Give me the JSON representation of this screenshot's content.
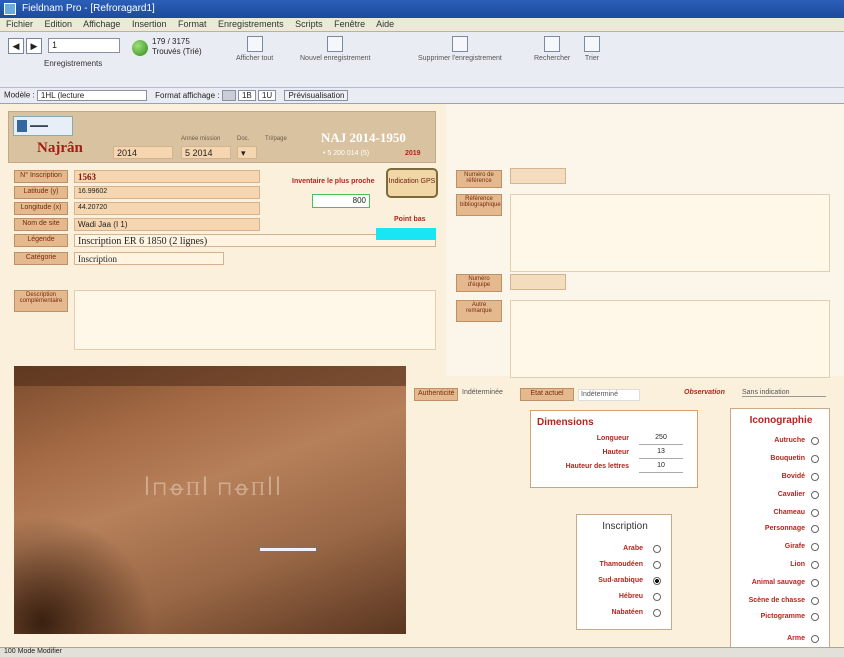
{
  "window": {
    "title": "Fieldnam Pro - [Refroragard1]"
  },
  "menu": [
    "Fichier",
    "Edition",
    "Affichage",
    "Insertion",
    "Format",
    "Enregistrements",
    "Scripts",
    "Fenêtre",
    "Aide"
  ],
  "toolbar": {
    "record_label": "Enregistrements",
    "record_input": "1",
    "found_count": "179 / 3175",
    "found_label": "Trouvés (Trié)",
    "tools": [
      "Afficher tout",
      "Nouvel enregistrement",
      "Supprimer l'enregistrement",
      "Rechercher",
      "Trier"
    ]
  },
  "layoutbar": {
    "layout_label": "Modèle :",
    "layout_value": "1HL (lecture",
    "format_label": "Format affichage :",
    "zoom_a": "1B",
    "zoom_b": "1U",
    "preview_button": "Prévisualisation"
  },
  "record": {
    "site": "Najrân",
    "year_box": "2014",
    "date_label": "Année mission",
    "date_value": "5 2014",
    "doc_label": "Doc.",
    "sort_label": "Tri/page",
    "header_number": "NAJ 2014-1950",
    "header_sub": "• 5 200 014 (5)",
    "header_small": "2019",
    "inscription_label": "N° Inscription",
    "inscription_value": "1563",
    "latitude_label": "Latitude (y)",
    "latitude_value": "16.99602",
    "longitude_label": "Longitude (x)",
    "longitude_value": "44.20720",
    "site_label": "Nom de site",
    "site_value": "Wadi Jaa (I 1)",
    "legend_label": "Légende",
    "legend_value": "Inscription ER 6 1850 (2 lignes)",
    "category_label": "Catégorie",
    "category_value": "Inscription",
    "description_label": "Description complémentaire",
    "distance_label": "Inventaire le plus proche",
    "distance_value": "800",
    "button_gps": "Indication GPS",
    "point_bas_label": "Point bas",
    "ref_label": "Numéro de référence",
    "commentary_label": "Référence bibliographique",
    "range_label": "Numéro d'équipe",
    "other_label": "Autre remarque",
    "authenticity_label": "Authenticité",
    "authenticity_value": "Indéterminée",
    "state_label": "Etat actuel",
    "state_value": "Indéterminé",
    "observation_label": "Observation",
    "observation_value": "Sans indication"
  },
  "dimensions": {
    "title": "Dimensions",
    "rows": [
      {
        "label": "Longueur",
        "value": "250"
      },
      {
        "label": "Hauteur",
        "value": "13"
      },
      {
        "label": "Hauteur des lettres",
        "value": "10"
      }
    ]
  },
  "inscription": {
    "title": "Inscription",
    "options": [
      {
        "label": "Arabe",
        "on": false
      },
      {
        "label": "Thamoudéen",
        "on": false
      },
      {
        "label": "Sud-arabique",
        "on": true
      },
      {
        "label": "Hébreu",
        "on": false
      },
      {
        "label": "Nabatéen",
        "on": false
      }
    ]
  },
  "iconographie": {
    "title": "Iconographie",
    "options": [
      "Autruche",
      "Bouquetin",
      "Bovidé",
      "Cavalier",
      "Chameau",
      "Personnage",
      "Girafe",
      "Lion",
      "Animal sauvage",
      "Scène de chasse",
      "Pictogramme",
      "Arme"
    ]
  },
  "photo": {
    "caption": "Inscription"
  },
  "statusbar": {
    "text": "100  Mode Modifier"
  }
}
